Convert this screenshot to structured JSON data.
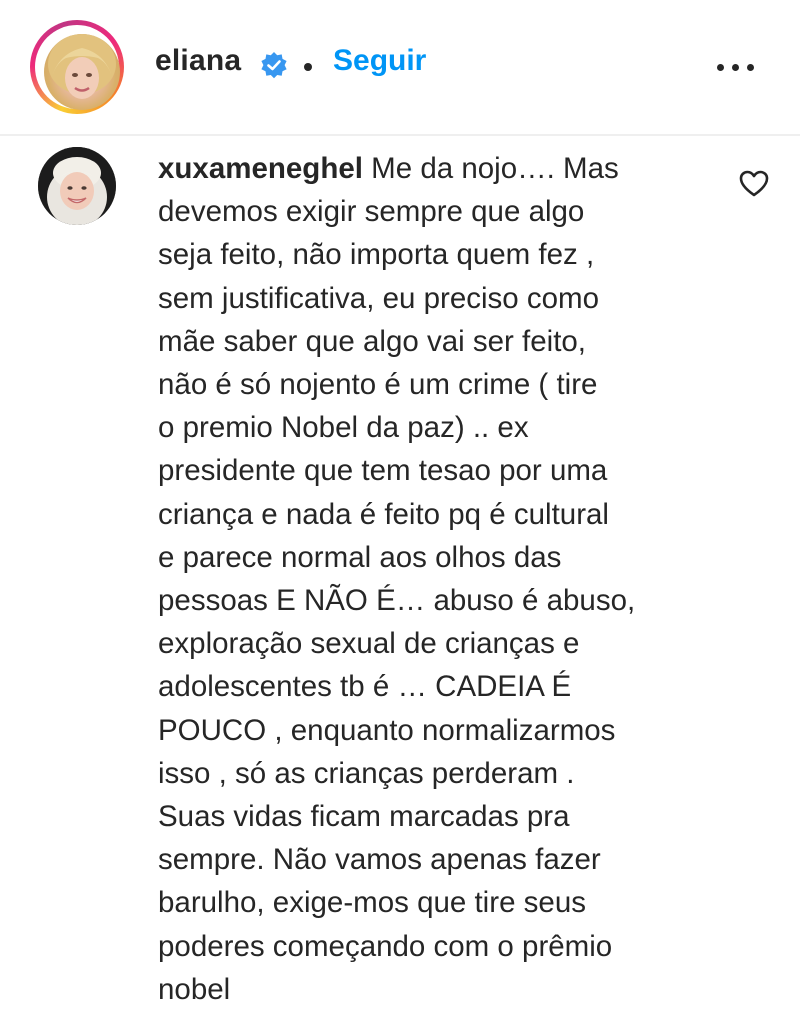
{
  "post_header": {
    "username": "eliana",
    "verified": true,
    "follow_label": "Seguir",
    "more_icon": "more-horizontal-icon",
    "accent_color": "#0095f6"
  },
  "comment": {
    "username": "xuxameneghel",
    "lines": [
      " Me da nojo…. Mas",
      "devemos exigir sempre que algo",
      "seja feito, não importa quem fez ,",
      "sem justificativa, eu preciso como",
      "mãe saber que algo vai ser feito,",
      "não é só nojento é um crime ( tire",
      "o premio Nobel da paz) .. ex",
      "presidente que tem tesao por uma",
      "criança e nada é feito pq é cultural",
      "e parece normal aos olhos das",
      "pessoas E NÃO É… abuso é abuso,",
      "exploração sexual de crianças e",
      "adolescentes tb é … CADEIA É",
      "POUCO , enquanto normalizarmos",
      "isso , só as crianças perderam .",
      "Suas vidas ficam marcadas pra",
      "sempre. Não vamos apenas fazer",
      "barulho, exige-mos que tire seus",
      "poderes começando com o prêmio",
      "nobel"
    ],
    "like_icon": "heart-outline-icon"
  }
}
